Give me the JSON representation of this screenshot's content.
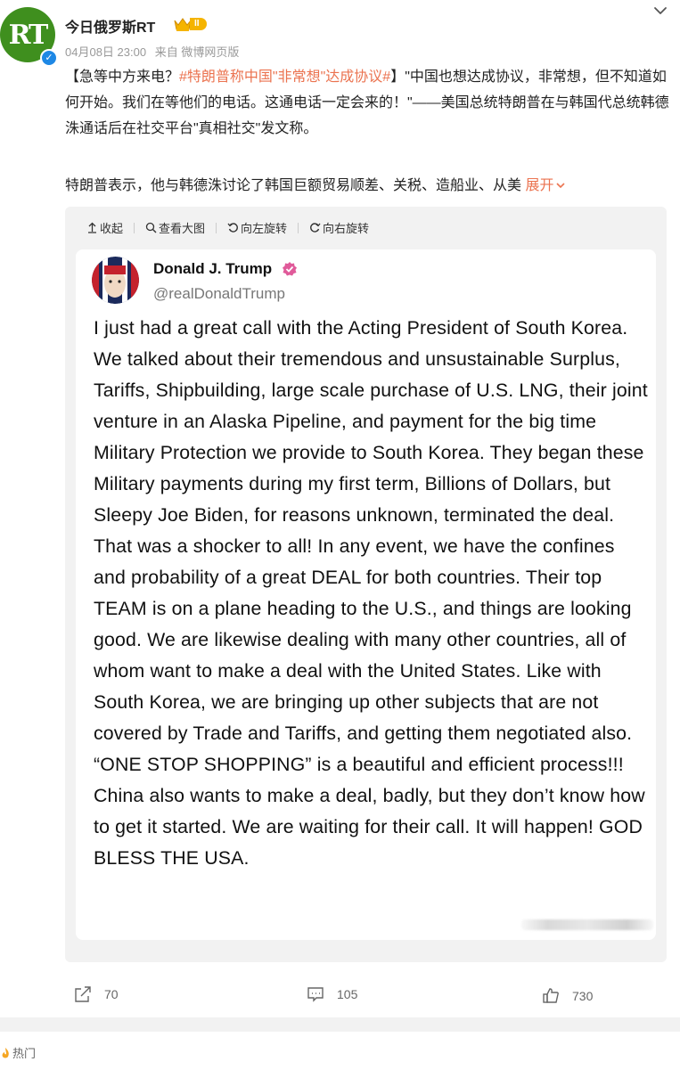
{
  "post": {
    "account_name": "今日俄罗斯RT",
    "avatar_text": "RT",
    "verified_mark": "✓",
    "vip_level": "II",
    "date": "04月08日 23:00",
    "source": "来自 微博网页版",
    "text_open_bracket": "【急等中方来电？",
    "hashtag": "#特朗普称中国\"非常想\"达成协议#",
    "text_rest": "】\"中国也想达成协议，非常想，但不知道如何开始。我们在等他们的电话。这通电话一定会来的！\"——美国总统特朗普在与韩国代总统韩德洙通话后在社交平台\"真相社交\"发文称。",
    "text_second": "特朗普表示，他与韩德洙讨论了韩国巨额贸易顺差、关税、造船业、从美",
    "expand_label": "展开"
  },
  "toolbar": {
    "collapse": "收起",
    "view_large": "查看大图",
    "rotate_left": "向左旋转",
    "rotate_right": "向右旋转"
  },
  "embedded": {
    "name": "Donald J. Trump",
    "handle": "@realDonaldTrump",
    "body": "I just had a great call with the Acting President of South Korea. We talked about their tremendous and unsustainable Surplus, Tariffs, Shipbuilding, large scale purchase of U.S. LNG, their joint venture in an Alaska Pipeline, and payment for the big time Military Protection we provide to South Korea. They began these Military payments during my first term, Billions of Dollars, but Sleepy Joe Biden, for reasons unknown, terminated the deal. That was a shocker to all! In any event, we have the confines and probability of a great DEAL for both countries. Their top TEAM is on a plane heading to the U.S., and things are looking good. We are likewise dealing with many other countries, all of whom want to make a deal with the United States. Like with South Korea, we are bringing up other subjects that are not covered by Trade and Tariffs, and getting them negotiated also. “ONE STOP SHOPPING” is a beautiful and efficient process!!! China also wants to make a deal, badly, but they don’t know how to get it started. We are waiting for their call. It will happen! GOD BLESS THE USA."
  },
  "actions": {
    "share_count": "70",
    "comment_count": "105",
    "like_count": "730"
  },
  "footer": {
    "hot_label": "热门"
  },
  "colors": {
    "accent": "#eb7350",
    "rt_green": "#3f8f1e",
    "verified_blue": "#1e88e5",
    "truth_badge": "#e05a9a"
  }
}
